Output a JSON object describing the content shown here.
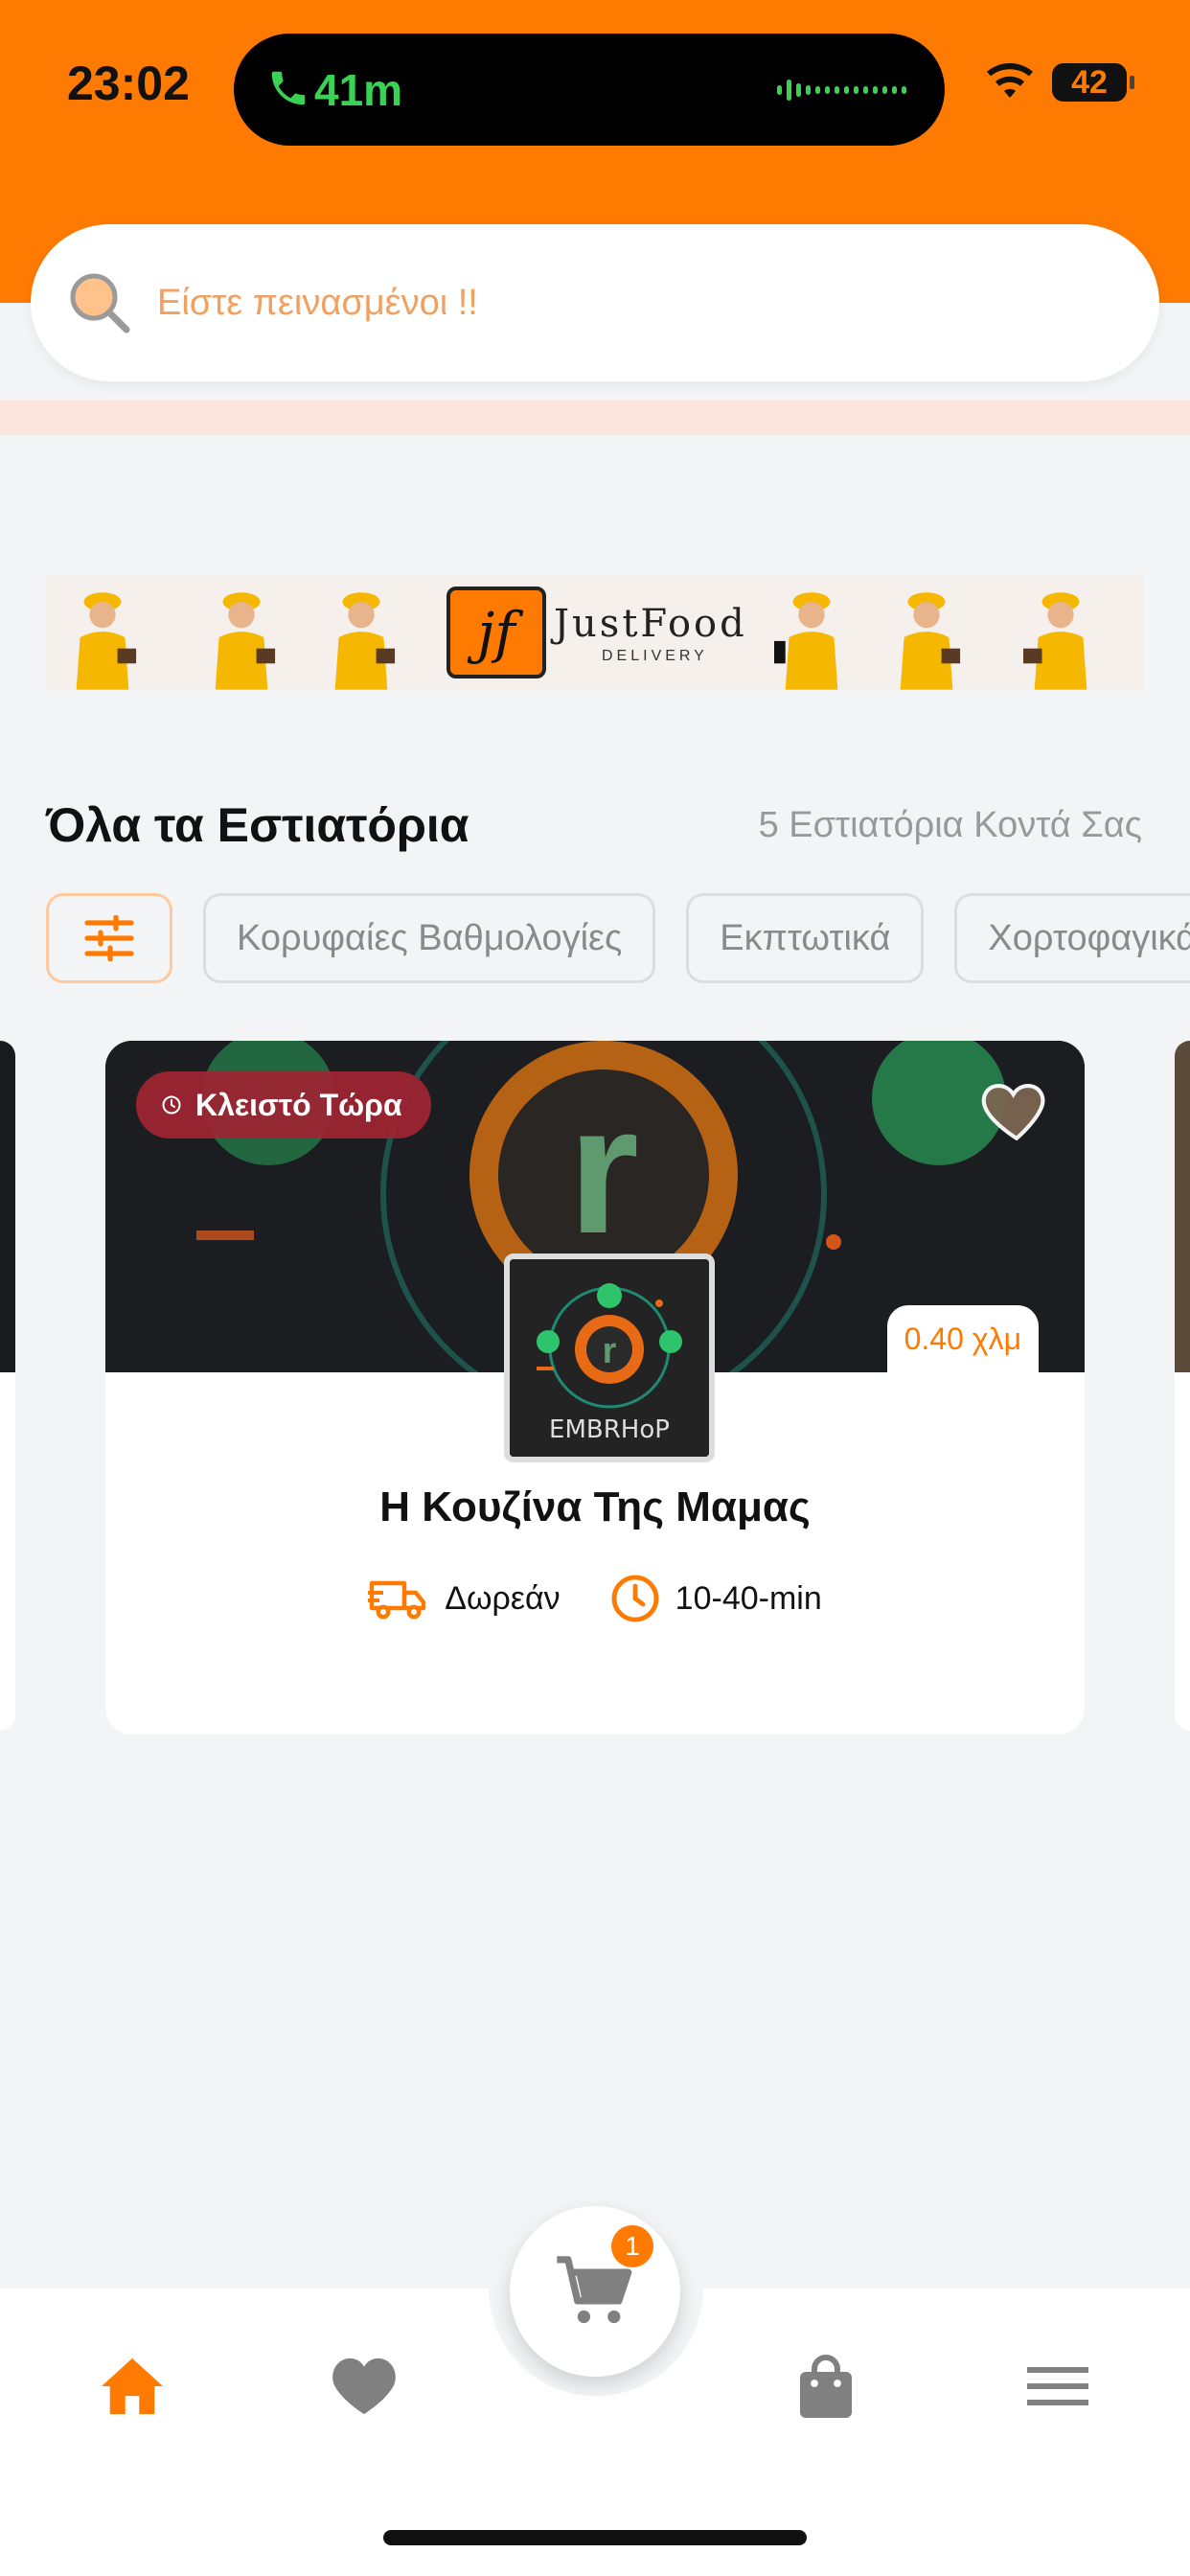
{
  "status_bar": {
    "time": "23:02",
    "call_duration": "41m",
    "battery": "42"
  },
  "search": {
    "placeholder": "Είστε πεινασμένοι !!"
  },
  "banner": {
    "logo_letters": "jf",
    "brand": "JustFood",
    "brand_sub": "DELIVERY"
  },
  "restaurants_section": {
    "title": "Όλα τα Εστιατόρια",
    "count_text": "5 Εστιατόρια Κοντά Σας"
  },
  "chips": [
    {
      "label": "Κορυφαίες Βαθμολογίες"
    },
    {
      "label": "Εκπτωτικά"
    },
    {
      "label": "Χορτοφαγικά"
    }
  ],
  "restaurant_card": {
    "status": "Κλειστό Τώρα",
    "distance": "0.40 χλμ",
    "logo_text": "EMBRHoP",
    "name": "Η Κουζίνα Της Μαμας",
    "delivery": "Δωρεάν",
    "time": "10-40-min"
  },
  "nav": {
    "cart_count": "1"
  },
  "colors": {
    "accent": "#ff7a00",
    "closed_badge": "#a02432",
    "background": "#f3f4f6"
  }
}
